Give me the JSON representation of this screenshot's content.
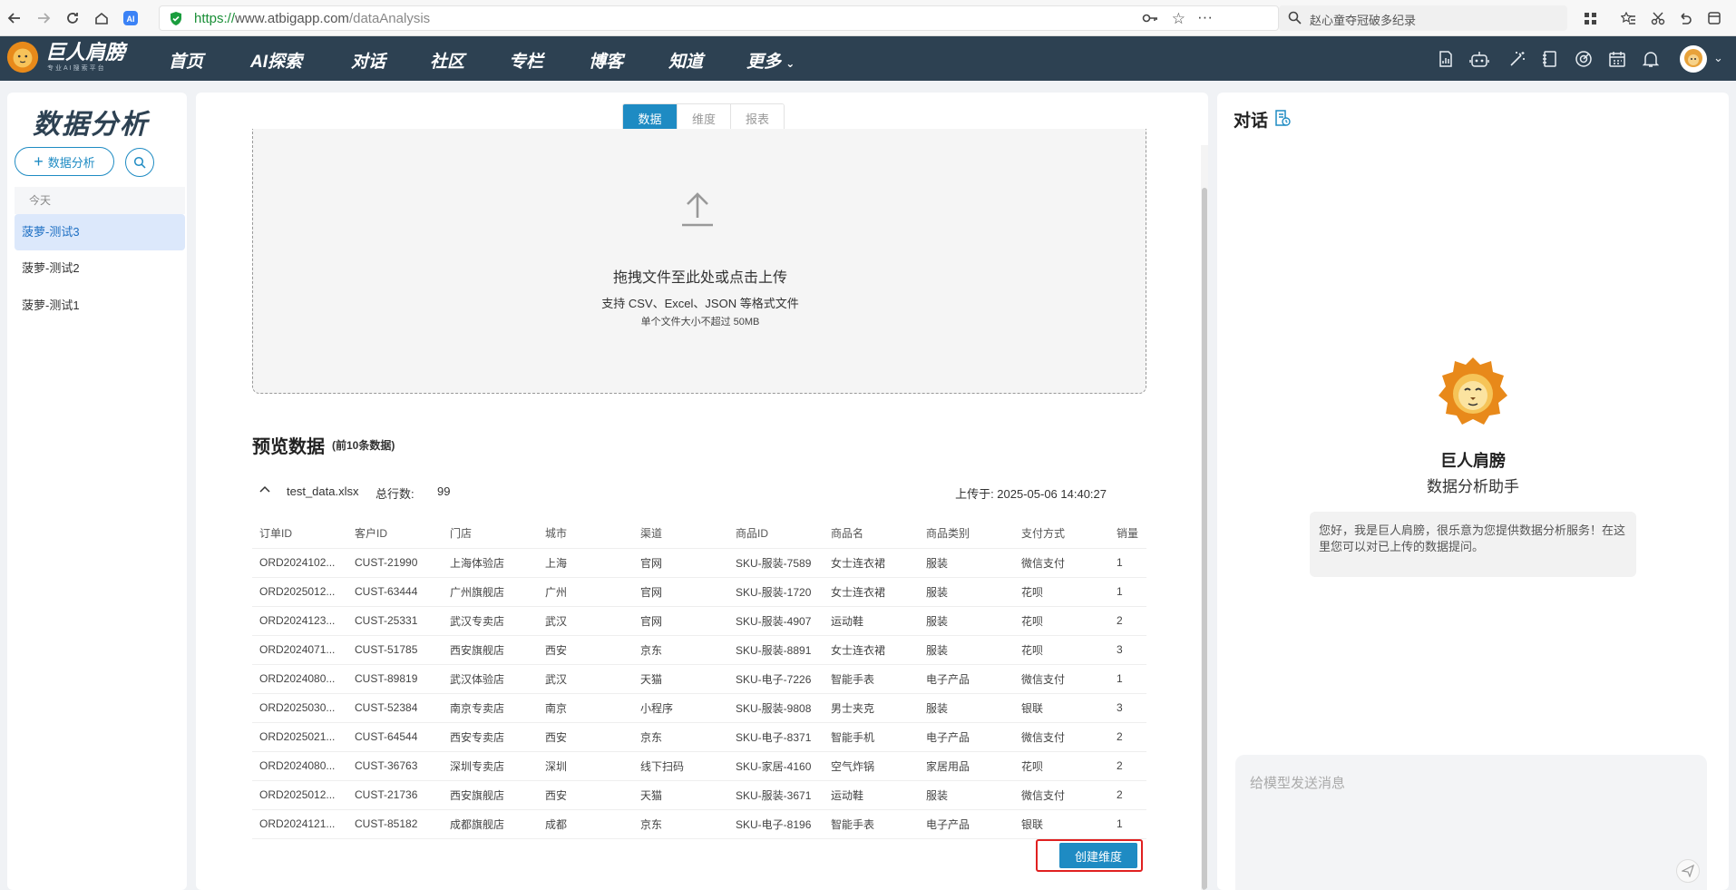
{
  "browser": {
    "url_proto": "https://",
    "url_host": "www.atbigapp.com",
    "url_path": "/dataAnalysis",
    "search_text": "赵心童夺冠破多纪录"
  },
  "header": {
    "logo_text": "巨人肩膀",
    "logo_sub": "专业AI搜索平台",
    "nav": [
      "首页",
      "AI探索",
      "对话",
      "社区",
      "专栏",
      "博客",
      "知道",
      "更多"
    ]
  },
  "sidebar": {
    "title": "数据分析",
    "new_label": "数据分析",
    "group_label": "今天",
    "sessions": [
      "菠萝-测试3",
      "菠萝-测试2",
      "菠萝-测试1"
    ]
  },
  "main": {
    "tabs": [
      "数据",
      "维度",
      "报表"
    ],
    "dropzone": {
      "main": "拖拽文件至此处或点击上传",
      "sub": "支持 CSV、Excel、JSON 等格式文件",
      "sub2": "单个文件大小不超过 50MB"
    },
    "preview_title": "预览数据",
    "preview_note": "(前10条数据)",
    "file": {
      "name": "test_data.xlsx",
      "count_label": "总行数:",
      "count": "99",
      "uploaded": "上传于: 2025-05-06 14:40:27"
    },
    "columns": [
      "订单ID",
      "客户ID",
      "门店",
      "城市",
      "渠道",
      "商品ID",
      "商品名",
      "商品类别",
      "支付方式",
      "销量"
    ],
    "rows": [
      [
        "ORD2024102...",
        "CUST-21990",
        "上海体验店",
        "上海",
        "官网",
        "SKU-服装-7589",
        "女士连衣裙",
        "服装",
        "微信支付",
        "1"
      ],
      [
        "ORD2025012...",
        "CUST-63444",
        "广州旗舰店",
        "广州",
        "官网",
        "SKU-服装-1720",
        "女士连衣裙",
        "服装",
        "花呗",
        "1"
      ],
      [
        "ORD2024123...",
        "CUST-25331",
        "武汉专卖店",
        "武汉",
        "官网",
        "SKU-服装-4907",
        "运动鞋",
        "服装",
        "花呗",
        "2"
      ],
      [
        "ORD2024071...",
        "CUST-51785",
        "西安旗舰店",
        "西安",
        "京东",
        "SKU-服装-8891",
        "女士连衣裙",
        "服装",
        "花呗",
        "3"
      ],
      [
        "ORD2024080...",
        "CUST-89819",
        "武汉体验店",
        "武汉",
        "天猫",
        "SKU-电子-7226",
        "智能手表",
        "电子产品",
        "微信支付",
        "1"
      ],
      [
        "ORD2025030...",
        "CUST-52384",
        "南京专卖店",
        "南京",
        "小程序",
        "SKU-服装-9808",
        "男士夹克",
        "服装",
        "银联",
        "3"
      ],
      [
        "ORD2025021...",
        "CUST-64544",
        "西安专卖店",
        "西安",
        "京东",
        "SKU-电子-8371",
        "智能手机",
        "电子产品",
        "微信支付",
        "2"
      ],
      [
        "ORD2024080...",
        "CUST-36763",
        "深圳专卖店",
        "深圳",
        "线下扫码",
        "SKU-家居-4160",
        "空气炸锅",
        "家居用品",
        "花呗",
        "2"
      ],
      [
        "ORD2025012...",
        "CUST-21736",
        "西安旗舰店",
        "西安",
        "天猫",
        "SKU-服装-3671",
        "运动鞋",
        "服装",
        "微信支付",
        "2"
      ],
      [
        "ORD2024121...",
        "CUST-85182",
        "成都旗舰店",
        "成都",
        "京东",
        "SKU-电子-8196",
        "智能手表",
        "电子产品",
        "银联",
        "1"
      ]
    ],
    "create_label": "创建维度"
  },
  "chat": {
    "title": "对话",
    "bot_name": "巨人肩膀",
    "bot_sub": "数据分析助手",
    "greeting": "您好，我是巨人肩膀，很乐意为您提供数据分析服务！在这里您可以对已上传的数据提问。",
    "input_placeholder": "给模型发送消息"
  },
  "colors": {
    "accent": "#1e8bc3",
    "header_bg": "#2d4152",
    "highlight_border": "#e02020"
  }
}
